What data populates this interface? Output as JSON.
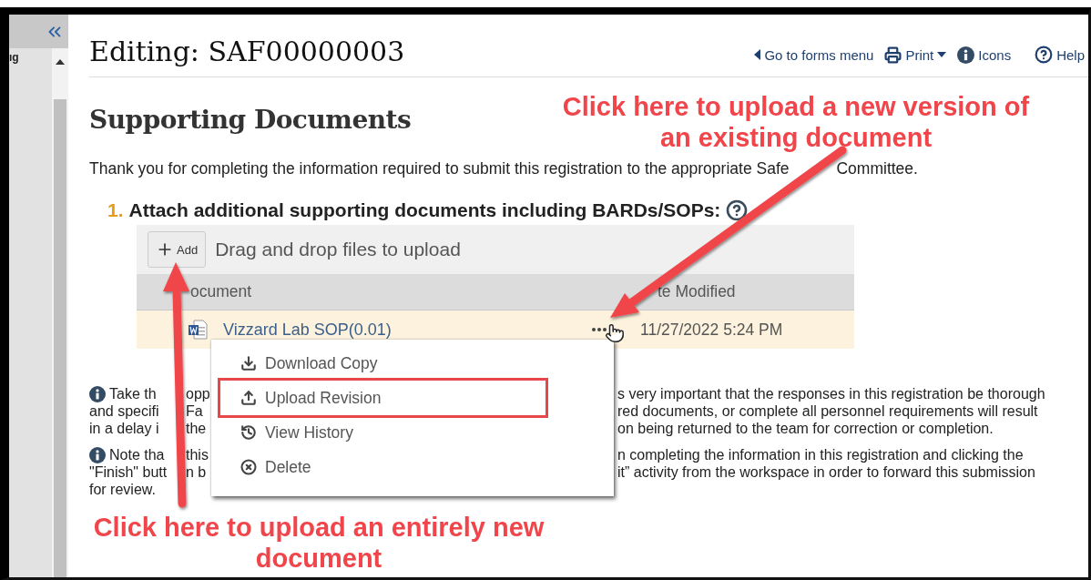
{
  "sidebar": {
    "label": "ıg"
  },
  "header": {
    "title": "Editing: SAF00000003",
    "actions": [
      {
        "kind": "back",
        "label": "Go to forms menu"
      },
      {
        "kind": "print",
        "label": "Print"
      },
      {
        "kind": "info",
        "label": "Icons"
      },
      {
        "kind": "help",
        "label": "Help"
      }
    ]
  },
  "section_title": "Supporting Documents",
  "intro": [
    "Thank you for completing the information required to submit this registration to the appropriate Safe",
    "Committee."
  ],
  "question": {
    "number": "1.",
    "text": "Attach additional supporting documents including BARDs/SOPs:"
  },
  "upload": {
    "add_label": "Add",
    "hint": "Drag and drop files to upload"
  },
  "table": {
    "columns": [
      "ocument",
      "te Modified"
    ],
    "rows": [
      {
        "name": "Vizzard Lab SOP(0.01)",
        "date": "11/27/2022 5:24 PM",
        "selected": true
      }
    ]
  },
  "menu": {
    "items": [
      {
        "kind": "download",
        "label": "Download Copy",
        "selected": false
      },
      {
        "kind": "upload",
        "label": "Upload Revision",
        "selected": true
      },
      {
        "kind": "history",
        "label": "View History",
        "selected": false
      },
      {
        "kind": "delete",
        "label": "Delete",
        "selected": false
      }
    ]
  },
  "notes": [
    {
      "lines": [
        {
          "left": "Take th",
          "middle": "opp",
          "right": "s very important that the responses in this registration be thorough"
        },
        {
          "left": "and specifi",
          "middle": "Fa",
          "right": "red documents, or complete all personnel requirements will result"
        },
        {
          "left": "in a delay i",
          "middle": "the",
          "right": "on being returned to the team for correction or completion."
        }
      ]
    },
    {
      "lines": [
        {
          "left": "Note tha",
          "middle": "this",
          "right": "n completing the information in this registration and clicking the"
        },
        {
          "left": "\"Finish\" butt",
          "middle": "n b",
          "right": "it” activity from the workspace in order to forward this submission"
        },
        {
          "left": "for review."
        }
      ]
    }
  ],
  "annotations": [
    {
      "lines": [
        "Click here to upload a new version of",
        "an existing document"
      ]
    },
    {
      "lines": [
        "Click here to upload an entirely new",
        "document"
      ]
    }
  ]
}
